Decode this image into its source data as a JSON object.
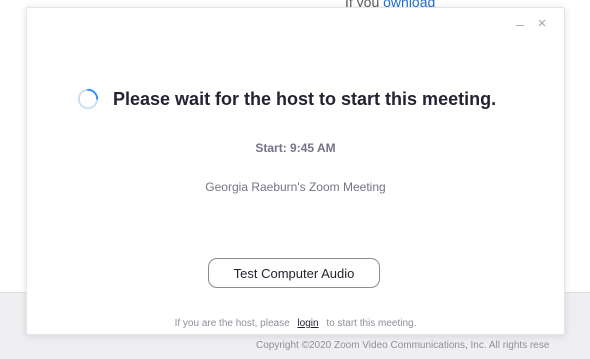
{
  "background": {
    "top_link_prefix": "If you",
    "top_link_text": "ownload",
    "copyright": "Copyright ©2020 Zoom Video Communications, Inc. All rights rese"
  },
  "window_controls": {
    "minimize_glyph": "–",
    "close_glyph": "×"
  },
  "dialog": {
    "status_title": "Please wait for the host to start this meeting.",
    "start_time": "Start: 9:45 AM",
    "meeting_name": "Georgia Raeburn's Zoom Meeting",
    "test_audio_label": "Test Computer Audio",
    "host_prefix": "If you are the host, please",
    "login_label": "login",
    "host_suffix": "to start this meeting."
  },
  "colors": {
    "spinner_accent": "#2d8cff",
    "title_text": "#232333",
    "secondary_text": "#747487"
  },
  "icons": {
    "spinner": "loading-spinner-icon"
  }
}
